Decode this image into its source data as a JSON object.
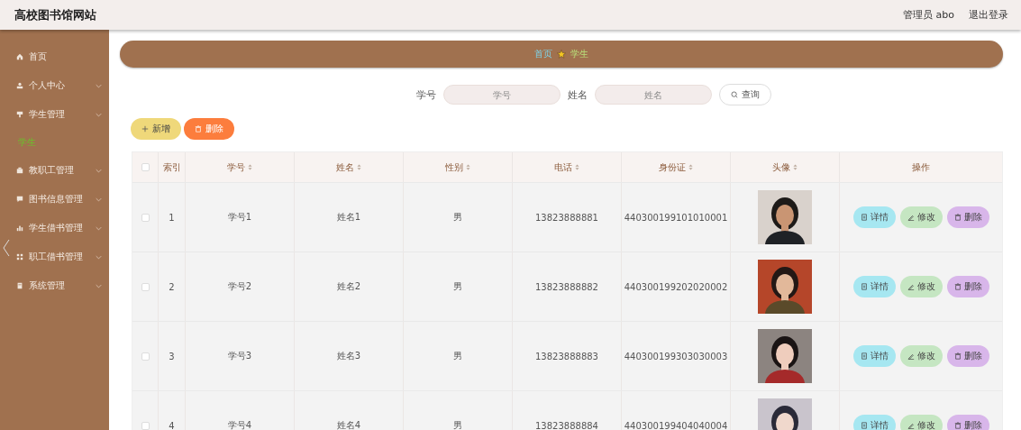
{
  "header": {
    "title": "高校图书馆网站",
    "user": "管理员 abo",
    "logout": "退出登录"
  },
  "sidebar": {
    "items": [
      {
        "label": "首页",
        "expandable": false
      },
      {
        "label": "个人中心",
        "expandable": true
      },
      {
        "label": "学生管理",
        "expandable": true,
        "children": [
          {
            "label": "学生",
            "selected": true
          }
        ]
      },
      {
        "label": "教职工管理",
        "expandable": true
      },
      {
        "label": "图书信息管理",
        "expandable": true
      },
      {
        "label": "学生借书管理",
        "expandable": true
      },
      {
        "label": "职工借书管理",
        "expandable": true
      },
      {
        "label": "系统管理",
        "expandable": true
      }
    ]
  },
  "breadcrumb": [
    "首页",
    "学生"
  ],
  "search": {
    "fields": [
      {
        "label": "学号",
        "placeholder": "学号"
      },
      {
        "label": "姓名",
        "placeholder": "姓名"
      }
    ],
    "button": "查询"
  },
  "actions": {
    "add": "新增",
    "delete": "删除"
  },
  "table": {
    "header_checked": false,
    "columns": [
      "索引",
      "学号",
      "姓名",
      "性别",
      "电话",
      "身份证",
      "头像",
      "操作"
    ],
    "rows": [
      {
        "checked": false,
        "cells": [
          "1",
          "学号1",
          "姓名1",
          "男",
          "13823888881",
          "440300199101010001"
        ],
        "avatar": {
          "kind": "picture"
        },
        "buttons": [
          "详情",
          "修改",
          "删除"
        ]
      },
      {
        "checked": false,
        "cells": [
          "2",
          "学号2",
          "姓名2",
          "男",
          "13823888882",
          "440300199202020002"
        ],
        "avatar": {
          "kind": "picture"
        },
        "buttons": [
          "详情",
          "修改",
          "删除"
        ]
      },
      {
        "checked": false,
        "cells": [
          "3",
          "学号3",
          "姓名3",
          "男",
          "13823888883",
          "440300199303030003"
        ],
        "avatar": {
          "kind": "picture"
        },
        "buttons": [
          "详情",
          "修改",
          "删除"
        ]
      },
      {
        "checked": false,
        "cells": [
          "4",
          "学号4",
          "姓名4",
          "男",
          "13823888884",
          "440300199404040004"
        ],
        "avatar": {
          "kind": "picture"
        },
        "buttons": [
          "详情",
          "修改",
          "删除"
        ]
      }
    ]
  }
}
